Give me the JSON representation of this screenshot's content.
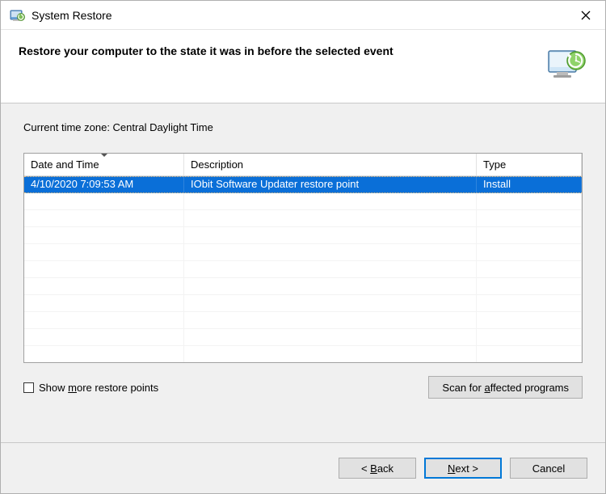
{
  "titlebar": {
    "title": "System Restore"
  },
  "header": {
    "heading": "Restore your computer to the state it was in before the selected event"
  },
  "body": {
    "timezone_label": "Current time zone: Central Daylight Time"
  },
  "table": {
    "columns": {
      "date": "Date and Time",
      "desc": "Description",
      "type": "Type"
    },
    "rows": [
      {
        "date": "4/10/2020 7:09:53 AM",
        "desc": "IObit Software Updater restore point",
        "type": "Install",
        "selected": true
      }
    ]
  },
  "options": {
    "show_more_prefix": "Show ",
    "show_more_underlined": "m",
    "show_more_suffix": "ore restore points",
    "scan_prefix": "Scan for ",
    "scan_underlined": "a",
    "scan_suffix": "ffected programs"
  },
  "footer": {
    "back": "< Back",
    "next_underlined": "N",
    "next_suffix": "ext >",
    "cancel": "Cancel"
  }
}
